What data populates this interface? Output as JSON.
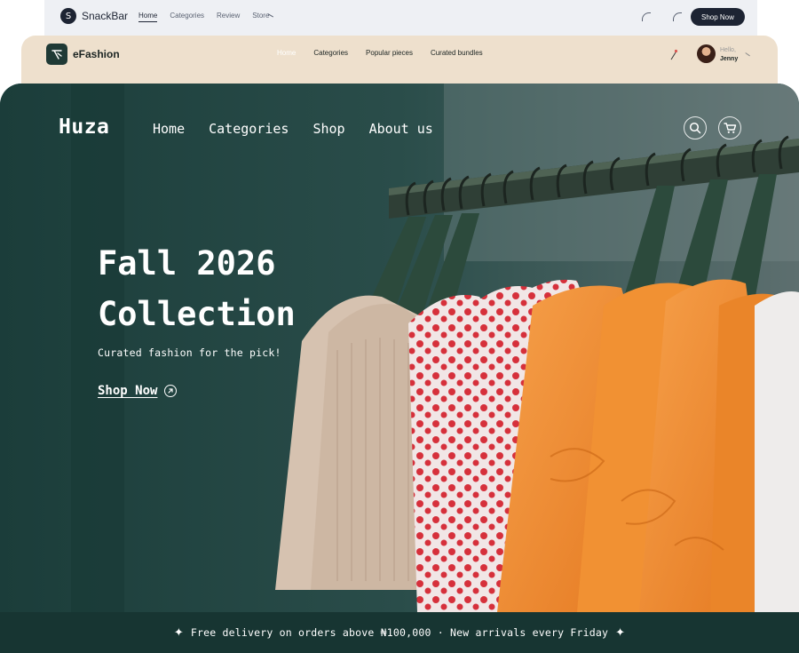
{
  "snackbar": {
    "brand": "SnackBar",
    "logo_letter": "S",
    "nav": [
      "Home",
      "Categories",
      "Review",
      "Store"
    ],
    "cta": "Shop Now"
  },
  "efashion": {
    "brand": "eFashion",
    "nav": [
      "Home",
      "Categories",
      "Popular pieces",
      "Curated bundles"
    ],
    "user_greeting": "Hello,",
    "user_name": "Jenny"
  },
  "huza": {
    "brand": "Huza",
    "nav": [
      "Home",
      "Categories",
      "Shop",
      "About us"
    ],
    "hero": {
      "title_line1": "Fall 2026",
      "title_line2": "Collection",
      "subtitle": "Curated fashion for the pick!",
      "cta": "Shop Now"
    },
    "promo": {
      "text": "Free delivery on orders above ₦100,000 · New arrivals every Friday",
      "sparkle": "✦"
    }
  },
  "colors": {
    "hero_green": "#1f4340",
    "promo_green": "#173532",
    "fashion_beige": "#eee0cd",
    "snack_grey": "#eef0f4",
    "accent_orange": "#f2913a"
  },
  "icons": [
    "search-icon",
    "cart-icon",
    "arrow-up-right-icon",
    "sparkle-icon",
    "location-pin-icon"
  ]
}
